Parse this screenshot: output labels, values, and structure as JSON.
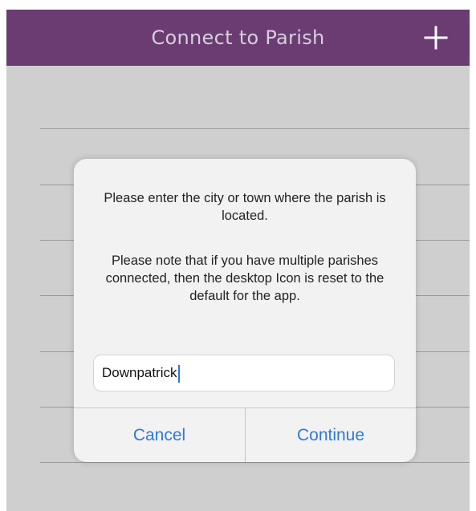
{
  "header": {
    "title": "Connect to Parish",
    "add_icon": "plus-icon"
  },
  "dialog": {
    "message_1": "Please enter the city or town where the parish is located.",
    "message_2": "Please note that if you have multiple parishes connected, then the desktop Icon is reset to the default for the app.",
    "input_value": "Downpatrick",
    "cancel_label": "Cancel",
    "continue_label": "Continue"
  },
  "colors": {
    "header_bg": "#6a3c72",
    "screen_bg": "#cfcfcf",
    "dialog_bg": "#f2f2f2",
    "button_text": "#2f7ad8"
  }
}
